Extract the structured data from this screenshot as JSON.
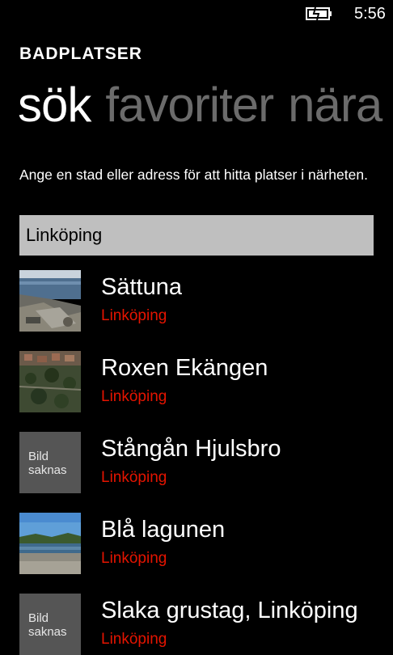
{
  "status_bar": {
    "time": "5:56",
    "battery_icon": "battery-charging-icon"
  },
  "app": {
    "title": "BADPLATSER"
  },
  "pivot": {
    "tabs": [
      {
        "label": "sök"
      },
      {
        "label": "favoriter"
      },
      {
        "label": "nära"
      }
    ]
  },
  "search": {
    "instruction": "Ange en stad eller adress för att hitta platser i närheten.",
    "value": "Linköping"
  },
  "results": [
    {
      "name": "Sättuna",
      "city": "Linköping",
      "thumbnail": "lake-photo"
    },
    {
      "name": "Roxen Ekängen",
      "city": "Linköping",
      "thumbnail": "aerial-photo"
    },
    {
      "name": "Stångån Hjulsbro",
      "city": "Linköping",
      "thumbnail": "missing",
      "missing_label_line1": "Bild",
      "missing_label_line2": "saknas"
    },
    {
      "name": "Blå lagunen",
      "city": "Linköping",
      "thumbnail": "lagoon-photo"
    },
    {
      "name": "Slaka grustag, Linköping",
      "city": "Linköping",
      "thumbnail": "missing",
      "missing_label_line1": "Bild",
      "missing_label_line2": "saknas"
    }
  ],
  "colors": {
    "background": "#000000",
    "accent_red": "#e51400",
    "inactive_pivot": "#6b6b6b",
    "search_box": "#bfbfbf"
  }
}
